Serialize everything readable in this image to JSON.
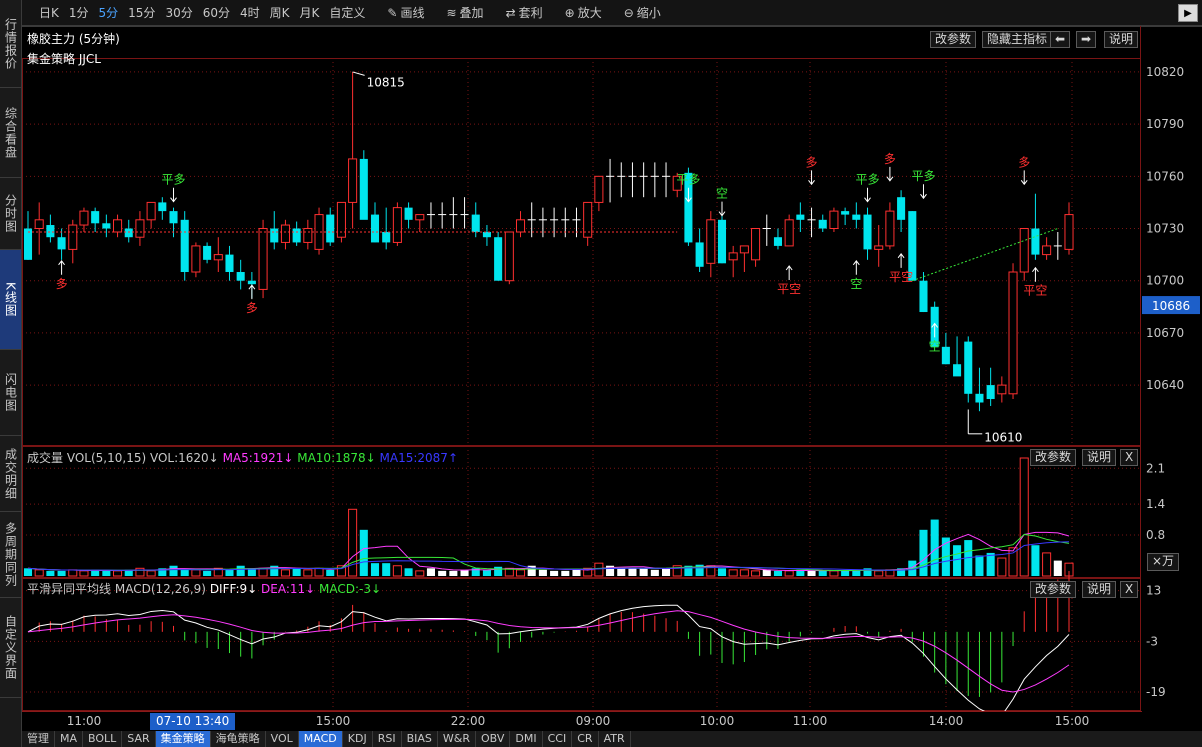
{
  "sidebar": [
    {
      "label": "行情报价",
      "active": false
    },
    {
      "label": "综合看盘",
      "active": false
    },
    {
      "label": "分时图",
      "active": false
    },
    {
      "label": "K线图",
      "active": true
    },
    {
      "label": "闪电图",
      "active": false
    },
    {
      "label": "成交明细",
      "active": false
    },
    {
      "label": "多周期同列",
      "active": false
    },
    {
      "label": "自定义界面",
      "active": false
    }
  ],
  "toolbar": {
    "periods": [
      "日K",
      "1分",
      "5分",
      "15分",
      "30分",
      "60分",
      "4时",
      "周K",
      "月K",
      "自定义"
    ],
    "active_period": "5分",
    "tools": [
      {
        "icon": "pencil-icon",
        "glyph": "✎",
        "label": "画线"
      },
      {
        "icon": "stack-icon",
        "glyph": "≋",
        "label": "叠加"
      },
      {
        "icon": "arbitrage-icon",
        "glyph": "⇄",
        "label": "套利"
      },
      {
        "icon": "zoom-in-icon",
        "glyph": "⊕",
        "label": "放大"
      },
      {
        "icon": "zoom-out-icon",
        "glyph": "⊖",
        "label": "缩小"
      }
    ]
  },
  "main_panel": {
    "title": "橡胶主力 (5分钟)",
    "strategy": "集金策略 JJCL",
    "btn_params": "改参数",
    "btn_hide": "隐藏主指标",
    "btn_left": "⬅",
    "btn_right": "➡",
    "btn_help": "说明",
    "current_price": "10686",
    "high_label": "10815",
    "low_label": "10610"
  },
  "volume_panel": {
    "label": "成交量",
    "formula": "VOL(5,10,15)",
    "vol": "VOL:1620↓",
    "ma5": "MA5:1921↓",
    "ma10": "MA10:1878↓",
    "ma15": "MA15:2087↑",
    "btn_params": "改参数",
    "btn_help": "说明",
    "btn_close": "X",
    "unit": "×万"
  },
  "macd_panel": {
    "label": "平滑异同平均线",
    "formula": "MACD(12,26,9)",
    "diff": "DIFF:9↓",
    "dea": "DEA:11↓",
    "macd": "MACD:-3↓",
    "btn_params": "改参数",
    "btn_help": "说明",
    "btn_close": "X"
  },
  "time_axis": {
    "labels": [
      "11:00",
      "15:00",
      "22:00",
      "09:00",
      "10:00",
      "11:00",
      "14:00",
      "15:00"
    ],
    "cursor": "07-10 13:40"
  },
  "bottom_tabs": [
    "管理",
    "MA",
    "BOLL",
    "SAR",
    "集金策略",
    "海龟策略",
    "VOL",
    "MACD",
    "KDJ",
    "RSI",
    "BIAS",
    "W&R",
    "OBV",
    "DMI",
    "CCI",
    "CR",
    "ATR"
  ],
  "bottom_tabs_active": [
    "集金策略",
    "MACD"
  ],
  "colors": {
    "up": "#ff3030",
    "down": "#00e5ee",
    "ma5": "#ff3cff",
    "ma10": "#38e838",
    "ma15": "#3838ff",
    "grid": "#7a1414",
    "signal_up": "#ff3030",
    "signal_down": "#38e838"
  },
  "chart_data": [
    {
      "type": "candlestick",
      "title": "橡胶主力 (5分钟)",
      "y_ticks": [
        10640,
        10670,
        10700,
        10730,
        10760,
        10790,
        10820
      ],
      "ylim": [
        10605,
        10828
      ],
      "candles": [
        [
          10730,
          10740,
          10712,
          10712
        ],
        [
          10730,
          10745,
          10715,
          10735
        ],
        [
          10732,
          10738,
          10722,
          10725
        ],
        [
          10725,
          10730,
          10712,
          10718
        ],
        [
          10718,
          10735,
          10710,
          10732
        ],
        [
          10732,
          10742,
          10728,
          10740
        ],
        [
          10740,
          10742,
          10728,
          10733
        ],
        [
          10733,
          10738,
          10725,
          10730
        ],
        [
          10728,
          10738,
          10725,
          10735
        ],
        [
          10730,
          10735,
          10722,
          10725
        ],
        [
          10725,
          10740,
          10720,
          10735
        ],
        [
          10735,
          10745,
          10730,
          10745
        ],
        [
          10745,
          10748,
          10735,
          10740
        ],
        [
          10740,
          10742,
          10725,
          10733
        ],
        [
          10735,
          10740,
          10700,
          10705
        ],
        [
          10705,
          10722,
          10702,
          10720
        ],
        [
          10720,
          10722,
          10710,
          10712
        ],
        [
          10712,
          10725,
          10705,
          10715
        ],
        [
          10715,
          10720,
          10700,
          10705
        ],
        [
          10705,
          10712,
          10695,
          10700
        ],
        [
          10700,
          10705,
          10690,
          10698
        ],
        [
          10695,
          10735,
          10690,
          10730
        ],
        [
          10730,
          10740,
          10718,
          10722
        ],
        [
          10722,
          10735,
          10718,
          10732
        ],
        [
          10730,
          10734,
          10720,
          10722
        ],
        [
          10722,
          10735,
          10718,
          10730
        ],
        [
          10718,
          10742,
          10715,
          10738
        ],
        [
          10738,
          10742,
          10720,
          10722
        ],
        [
          10725,
          10745,
          10722,
          10745
        ],
        [
          10745,
          10820,
          10730,
          10770
        ],
        [
          10770,
          10775,
          10738,
          10735
        ],
        [
          10738,
          10745,
          10722,
          10722
        ],
        [
          10728,
          10742,
          10718,
          10722
        ],
        [
          10722,
          10745,
          10720,
          10742
        ],
        [
          10742,
          10745,
          10730,
          10735
        ],
        [
          10735,
          10738,
          10728,
          10738
        ],
        [
          10738,
          10745,
          10730,
          10738
        ],
        [
          10738,
          10745,
          10730,
          10738
        ],
        [
          10738,
          10748,
          10730,
          10738
        ],
        [
          10738,
          10748,
          10730,
          10738
        ],
        [
          10738,
          10745,
          10725,
          10728
        ],
        [
          10728,
          10732,
          10720,
          10725
        ],
        [
          10725,
          10728,
          10700,
          10700
        ],
        [
          10700,
          10728,
          10698,
          10728
        ],
        [
          10728,
          10740,
          10725,
          10735
        ],
        [
          10735,
          10745,
          10725,
          10735
        ],
        [
          10735,
          10742,
          10725,
          10735
        ],
        [
          10735,
          10742,
          10725,
          10735
        ],
        [
          10735,
          10742,
          10725,
          10735
        ],
        [
          10735,
          10742,
          10725,
          10735
        ],
        [
          10725,
          10745,
          10720,
          10745
        ],
        [
          10745,
          10760,
          10740,
          10760
        ],
        [
          10760,
          10770,
          10745,
          10760
        ],
        [
          10760,
          10768,
          10748,
          10760
        ],
        [
          10760,
          10768,
          10748,
          10760
        ],
        [
          10760,
          10768,
          10748,
          10760
        ],
        [
          10760,
          10768,
          10748,
          10760
        ],
        [
          10760,
          10768,
          10748,
          10760
        ],
        [
          10752,
          10762,
          10748,
          10760
        ],
        [
          10762,
          10765,
          10720,
          10722
        ],
        [
          10722,
          10730,
          10705,
          10708
        ],
        [
          10710,
          10740,
          10702,
          10735
        ],
        [
          10735,
          10738,
          10710,
          10710
        ],
        [
          10712,
          10720,
          10702,
          10716
        ],
        [
          10716,
          10720,
          10705,
          10720
        ],
        [
          10712,
          10730,
          10708,
          10730
        ],
        [
          10730,
          10738,
          10720,
          10730
        ],
        [
          10725,
          10730,
          10718,
          10720
        ],
        [
          10720,
          10738,
          10720,
          10735
        ],
        [
          10738,
          10745,
          10728,
          10735
        ],
        [
          10735,
          10742,
          10725,
          10735
        ],
        [
          10735,
          10738,
          10728,
          10730
        ],
        [
          10730,
          10742,
          10728,
          10740
        ],
        [
          10740,
          10742,
          10732,
          10738
        ],
        [
          10738,
          10745,
          10730,
          10735
        ],
        [
          10738,
          10742,
          10712,
          10718
        ],
        [
          10718,
          10732,
          10708,
          10720
        ],
        [
          10720,
          10745,
          10718,
          10740
        ],
        [
          10748,
          10752,
          10728,
          10735
        ],
        [
          10740,
          10740,
          10700,
          10700
        ],
        [
          10700,
          10705,
          10682,
          10682
        ],
        [
          10685,
          10688,
          10662,
          10662
        ],
        [
          10662,
          10670,
          10652,
          10652
        ],
        [
          10652,
          10668,
          10648,
          10645
        ],
        [
          10665,
          10668,
          10630,
          10635
        ],
        [
          10635,
          10650,
          10625,
          10630
        ],
        [
          10640,
          10650,
          10628,
          10632
        ],
        [
          10635,
          10645,
          10630,
          10640
        ],
        [
          10635,
          10710,
          10632,
          10705
        ],
        [
          10705,
          10730,
          10700,
          10730
        ],
        [
          10730,
          10750,
          10712,
          10715
        ],
        [
          10715,
          10725,
          10712,
          10720
        ],
        [
          10720,
          10728,
          10712,
          10720
        ],
        [
          10718,
          10745,
          10715,
          10738
        ]
      ],
      "high": 10815,
      "low": 10610,
      "last": 10686
    },
    {
      "type": "bar",
      "title": "成交量",
      "y_ticks": [
        0.8,
        1.4,
        2.1
      ],
      "ylim": [
        0,
        2.3
      ],
      "series": [
        {
          "name": "MA5",
          "values": []
        },
        {
          "name": "MA10",
          "values": []
        },
        {
          "name": "MA15",
          "values": []
        }
      ],
      "volumes": [
        0.15,
        0.12,
        0.1,
        0.1,
        0.12,
        0.1,
        0.12,
        0.1,
        0.1,
        0.12,
        0.15,
        0.1,
        0.15,
        0.2,
        0.12,
        0.12,
        0.1,
        0.15,
        0.12,
        0.2,
        0.15,
        0.15,
        0.2,
        0.12,
        0.15,
        0.12,
        0.15,
        0.12,
        0.2,
        1.3,
        0.9,
        0.25,
        0.25,
        0.2,
        0.15,
        0.1,
        0.15,
        0.1,
        0.1,
        0.12,
        0.15,
        0.12,
        0.18,
        0.15,
        0.12,
        0.2,
        0.12,
        0.1,
        0.1,
        0.12,
        0.15,
        0.25,
        0.2,
        0.15,
        0.15,
        0.15,
        0.12,
        0.15,
        0.2,
        0.2,
        0.22,
        0.2,
        0.15,
        0.12,
        0.12,
        0.1,
        0.12,
        0.1,
        0.1,
        0.12,
        0.1,
        0.1,
        0.1,
        0.1,
        0.12,
        0.15,
        0.1,
        0.12,
        0.15,
        0.3,
        0.9,
        1.1,
        0.75,
        0.6,
        0.7,
        0.4,
        0.45,
        0.35,
        0.55,
        2.3,
        0.6,
        0.45,
        0.3,
        0.25
      ]
    },
    {
      "type": "macd",
      "title": "平滑异同平均线",
      "y_ticks": [
        13,
        -3,
        -19
      ],
      "ylim": [
        -25,
        17
      ]
    }
  ]
}
